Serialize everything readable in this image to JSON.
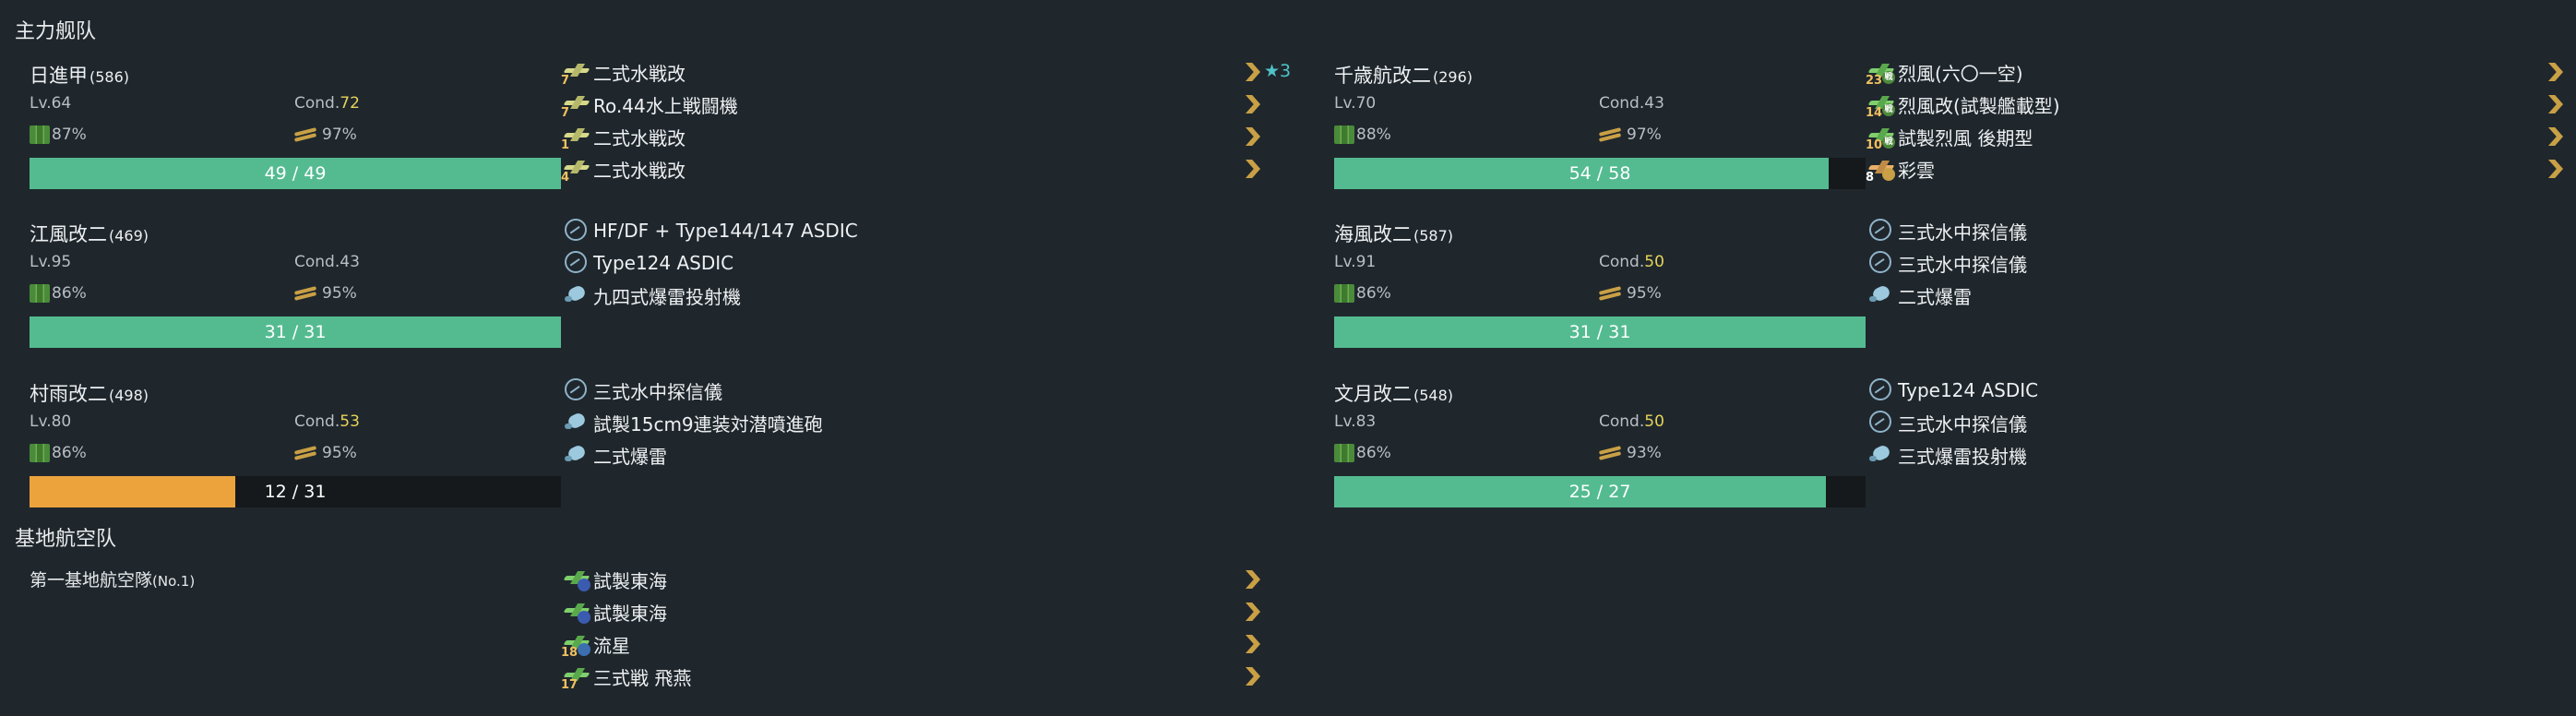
{
  "sections": {
    "main_fleet": "主力舰队",
    "land_base": "基地航空队"
  },
  "colors": {
    "hp_green": "#54bb91",
    "hp_orange": "#eca33c",
    "sparkle_cond": "#e6d35a",
    "chevron": "#c9a045",
    "star": "#4fc3c8"
  },
  "ships": [
    {
      "name": "日進甲",
      "id": "(586)",
      "lv": "Lv.64",
      "cond_label": "Cond.",
      "cond": "72",
      "cond_high": true,
      "fuel": "87%",
      "ammo": "97%",
      "hp_text": "49 / 49",
      "hp_ratio": 1.0,
      "hp_color": "green",
      "equips": [
        {
          "icon": "seaplane-fighter-icon",
          "slot": "7",
          "label": "二式水戦改",
          "chevron": true,
          "star": "★3"
        },
        {
          "icon": "seaplane-fighter-icon",
          "slot": "7",
          "label": "Ro.44水上戦闘機",
          "chevron": true
        },
        {
          "icon": "seaplane-fighter-icon",
          "slot": "1",
          "label": "二式水戦改",
          "chevron": true
        },
        {
          "icon": "seaplane-fighter-icon",
          "slot": "4",
          "label": "二式水戦改",
          "chevron": true
        }
      ]
    },
    {
      "name": "千歳航改二",
      "id": "(296)",
      "lv": "Lv.70",
      "cond_label": "Cond.",
      "cond": "43",
      "cond_high": false,
      "fuel": "88%",
      "ammo": "97%",
      "hp_text": "54 / 58",
      "hp_ratio": 0.931,
      "hp_color": "green",
      "equips": [
        {
          "icon": "fighter-icon",
          "slot": "23",
          "label": "烈風(六〇一空)",
          "chevron": true,
          "badge": "戦"
        },
        {
          "icon": "fighter-icon",
          "slot": "14",
          "label": "烈風改(試製艦載型)",
          "chevron": true,
          "badge": "戦"
        },
        {
          "icon": "fighter-icon",
          "slot": "10",
          "label": "試製烈風 後期型",
          "chevron": true,
          "badge": "戦"
        },
        {
          "icon": "recon-plane-icon",
          "slot": "8",
          "label": "彩雲",
          "chevron": true
        }
      ]
    },
    {
      "name": "江風改二",
      "id": "(469)",
      "lv": "Lv.95",
      "cond_label": "Cond.",
      "cond": "43",
      "cond_high": false,
      "fuel": "86%",
      "ammo": "95%",
      "hp_text": "31 / 31",
      "hp_ratio": 1.0,
      "hp_color": "green",
      "equips": [
        {
          "icon": "sonar-icon",
          "label": "HF/DF + Type144/147 ASDIC"
        },
        {
          "icon": "sonar-icon",
          "label": "Type124 ASDIC"
        },
        {
          "icon": "depth-charge-icon",
          "label": "九四式爆雷投射機"
        }
      ]
    },
    {
      "name": "海風改二",
      "id": "(587)",
      "lv": "Lv.91",
      "cond_label": "Cond.",
      "cond": "50",
      "cond_high": true,
      "fuel": "86%",
      "ammo": "95%",
      "hp_text": "31 / 31",
      "hp_ratio": 1.0,
      "hp_color": "green",
      "equips": [
        {
          "icon": "sonar-icon",
          "label": "三式水中探信儀"
        },
        {
          "icon": "sonar-icon",
          "label": "三式水中探信儀"
        },
        {
          "icon": "depth-charge-icon",
          "label": "二式爆雷"
        }
      ]
    },
    {
      "name": "村雨改二",
      "id": "(498)",
      "lv": "Lv.80",
      "cond_label": "Cond.",
      "cond": "53",
      "cond_high": true,
      "fuel": "86%",
      "ammo": "95%",
      "hp_text": "12 / 31",
      "hp_ratio": 0.387,
      "hp_color": "orange",
      "equips": [
        {
          "icon": "sonar-icon",
          "label": "三式水中探信儀"
        },
        {
          "icon": "depth-charge-icon",
          "label": "試製15cm9連装対潜噴進砲"
        },
        {
          "icon": "depth-charge-icon",
          "label": "二式爆雷"
        }
      ]
    },
    {
      "name": "文月改二",
      "id": "(548)",
      "lv": "Lv.83",
      "cond_label": "Cond.",
      "cond": "50",
      "cond_high": true,
      "fuel": "86%",
      "ammo": "93%",
      "hp_text": "25 / 27",
      "hp_ratio": 0.926,
      "hp_color": "green",
      "equips": [
        {
          "icon": "sonar-icon",
          "label": "Type124 ASDIC"
        },
        {
          "icon": "sonar-icon",
          "label": "三式水中探信儀"
        },
        {
          "icon": "depth-charge-icon",
          "label": "三式爆雷投射機"
        }
      ]
    }
  ],
  "land_base_corps": {
    "name": "第一基地航空隊",
    "number": "(No.1)",
    "equips": [
      {
        "icon": "land-bomber-icon",
        "label": "試製東海",
        "chevron": true
      },
      {
        "icon": "land-bomber-icon",
        "label": "試製東海",
        "chevron": true
      },
      {
        "icon": "torpedo-bomber-icon",
        "slot": "18",
        "label": "流星",
        "chevron": true
      },
      {
        "icon": "fighter-icon",
        "slot": "17",
        "label": "三式戦 飛燕",
        "chevron": true
      }
    ]
  }
}
